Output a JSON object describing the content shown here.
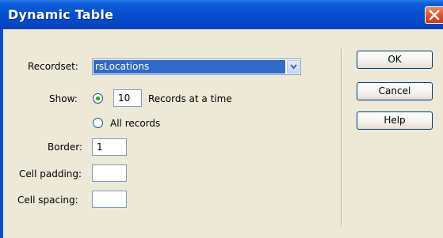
{
  "window": {
    "title": "Dynamic Table",
    "close_label": "Close"
  },
  "form": {
    "recordset_label": "Recordset:",
    "recordset_value": "rsLocations",
    "show_label": "Show:",
    "records_count": "10",
    "records_at_a_time_label": "Records at a time",
    "show_option": "records_at_a_time",
    "all_records_label": "All records",
    "border_label": "Border:",
    "border_value": "1",
    "cell_padding_label": "Cell padding:",
    "cell_padding_value": "",
    "cell_spacing_label": "Cell spacing:",
    "cell_spacing_value": ""
  },
  "buttons": {
    "ok": "OK",
    "cancel": "Cancel",
    "help": "Help"
  },
  "colors": {
    "titlebar": "#0550CF",
    "dialog_bg": "#ECE9D8",
    "selection": "#316AC5",
    "close": "#E2532F"
  }
}
